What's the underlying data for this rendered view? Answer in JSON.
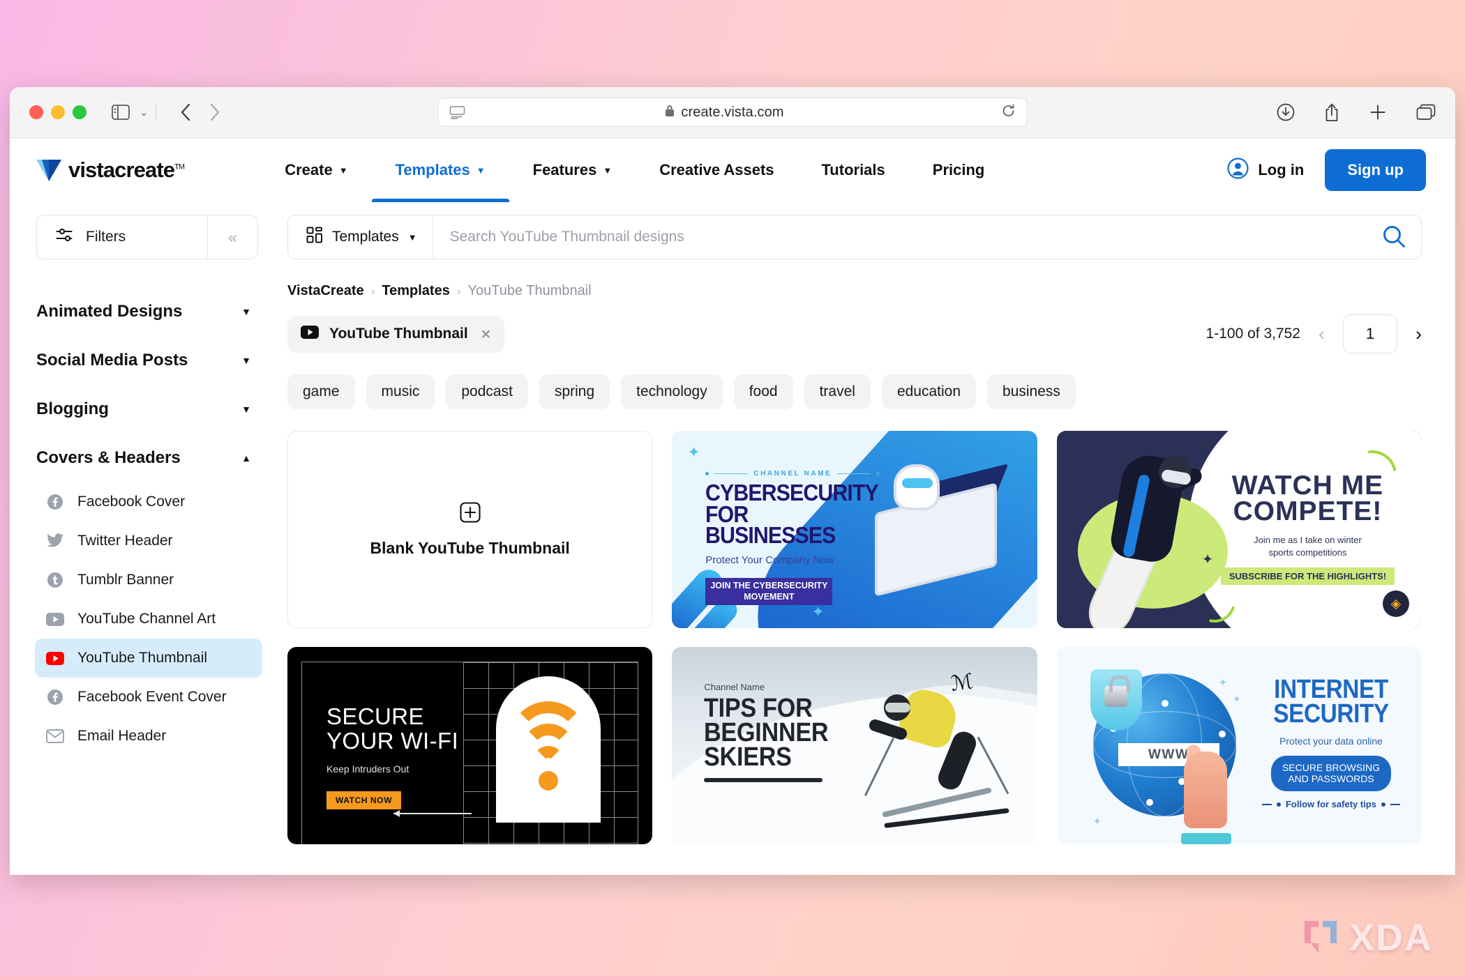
{
  "browser": {
    "url": "create.vista.com",
    "lock_icon": "lock-icon",
    "reader_icon": "reader-view-icon",
    "reload_icon": "reload-icon",
    "back_icon": "back-chevron-icon",
    "forward_icon": "forward-chevron-icon",
    "sidebar_icon": "sidebar-toggle-icon",
    "sidebar_chevron": "chevron-down-icon",
    "download_icon": "download-icon",
    "share_icon": "share-icon",
    "new_tab_icon": "plus-icon",
    "tabs_icon": "tab-overview-icon"
  },
  "header": {
    "logo_text": "vistacreate",
    "logo_tm": "TM",
    "nav": [
      {
        "label": "Create",
        "has_caret": true,
        "active": false
      },
      {
        "label": "Templates",
        "has_caret": true,
        "active": true
      },
      {
        "label": "Features",
        "has_caret": true,
        "active": false
      },
      {
        "label": "Creative Assets",
        "has_caret": false,
        "active": false
      },
      {
        "label": "Tutorials",
        "has_caret": false,
        "active": false
      },
      {
        "label": "Pricing",
        "has_caret": false,
        "active": false
      }
    ],
    "login_label": "Log in",
    "signup_label": "Sign up",
    "accent_color": "#0e6dd4"
  },
  "sidebar": {
    "filters_label": "Filters",
    "filters_icon": "sliders-icon",
    "collapse_icon": "double-chevron-left-icon",
    "groups": [
      {
        "label": "Animated Designs",
        "expanded": false,
        "arrow": "▼"
      },
      {
        "label": "Social Media Posts",
        "expanded": false,
        "arrow": "▼"
      },
      {
        "label": "Blogging",
        "expanded": false,
        "arrow": "▼"
      },
      {
        "label": "Covers & Headers",
        "expanded": true,
        "arrow": "▲"
      }
    ],
    "items": [
      {
        "label": "Facebook Cover",
        "icon": "facebook-icon",
        "selected": false
      },
      {
        "label": "Twitter Header",
        "icon": "twitter-icon",
        "selected": false
      },
      {
        "label": "Tumblr Banner",
        "icon": "tumblr-icon",
        "selected": false
      },
      {
        "label": "YouTube Channel Art",
        "icon": "youtube-icon",
        "selected": false
      },
      {
        "label": "YouTube Thumbnail",
        "icon": "youtube-icon",
        "selected": true
      },
      {
        "label": "Facebook Event Cover",
        "icon": "facebook-icon",
        "selected": false
      },
      {
        "label": "Email Header",
        "icon": "email-icon",
        "selected": false
      }
    ]
  },
  "search": {
    "scope_label": "Templates",
    "scope_icon": "grid-icon",
    "scope_caret": "▼",
    "placeholder": "Search YouTube Thumbnail designs",
    "value": "",
    "submit_icon": "search-icon"
  },
  "breadcrumb": {
    "items": [
      "VistaCreate",
      "Templates",
      "YouTube Thumbnail"
    ],
    "separator": "›"
  },
  "filter_chip": {
    "label": "YouTube Thumbnail",
    "icon": "youtube-icon",
    "close_icon": "close-icon"
  },
  "pagination": {
    "count_label": "1-100 of 3,752",
    "prev_icon": "chevron-left-icon",
    "next_icon": "chevron-right-icon",
    "current_page": "1"
  },
  "tags": [
    "game",
    "music",
    "podcast",
    "spring",
    "technology",
    "food",
    "travel",
    "education",
    "business"
  ],
  "templates": {
    "blank": {
      "label": "Blank YouTube Thumbnail",
      "icon": "plus-square-icon"
    },
    "cards": [
      {
        "id": "cybersecurity-for-businesses",
        "channel": "CHANNEL NAME",
        "title_line1": "CYBERSECURITY",
        "title_line2": "FOR BUSINESSES",
        "subtitle": "Protect Your Company Now",
        "cta_line1": "JOIN THE CYBERSECURITY",
        "cta_line2": "MOVEMENT"
      },
      {
        "id": "watch-me-compete",
        "title_line1": "WATCH ME",
        "title_line2": "COMPETE!",
        "subtitle_line1": "Join me as I take on winter",
        "subtitle_line2": "sports competitions",
        "cta": "SUBSCRIBE FOR THE HIGHLIGHTS!",
        "badge_icon": "premium-diamond-icon"
      },
      {
        "id": "secure-your-wifi",
        "title_line1": "SECURE",
        "title_line2": "YOUR WI-FI",
        "subtitle": "Keep Intruders Out",
        "cta": "WATCH NOW"
      },
      {
        "id": "tips-for-beginner-skiers",
        "channel": "Channel Name",
        "title_line1": "TIPS FOR",
        "title_line2": "BEGINNER",
        "title_line3": "SKIERS"
      },
      {
        "id": "internet-security",
        "title_line1": "INTERNET",
        "title_line2": "SECURITY",
        "subtitle": "Protect your data online",
        "cta_line1": "SECURE BROWSING",
        "cta_line2": "AND PASSWORDS",
        "footer": "Follow for safety tips",
        "url_text": "WWW"
      }
    ]
  },
  "watermark": {
    "text": "XDA",
    "icon": "xda-bracket-logo"
  }
}
